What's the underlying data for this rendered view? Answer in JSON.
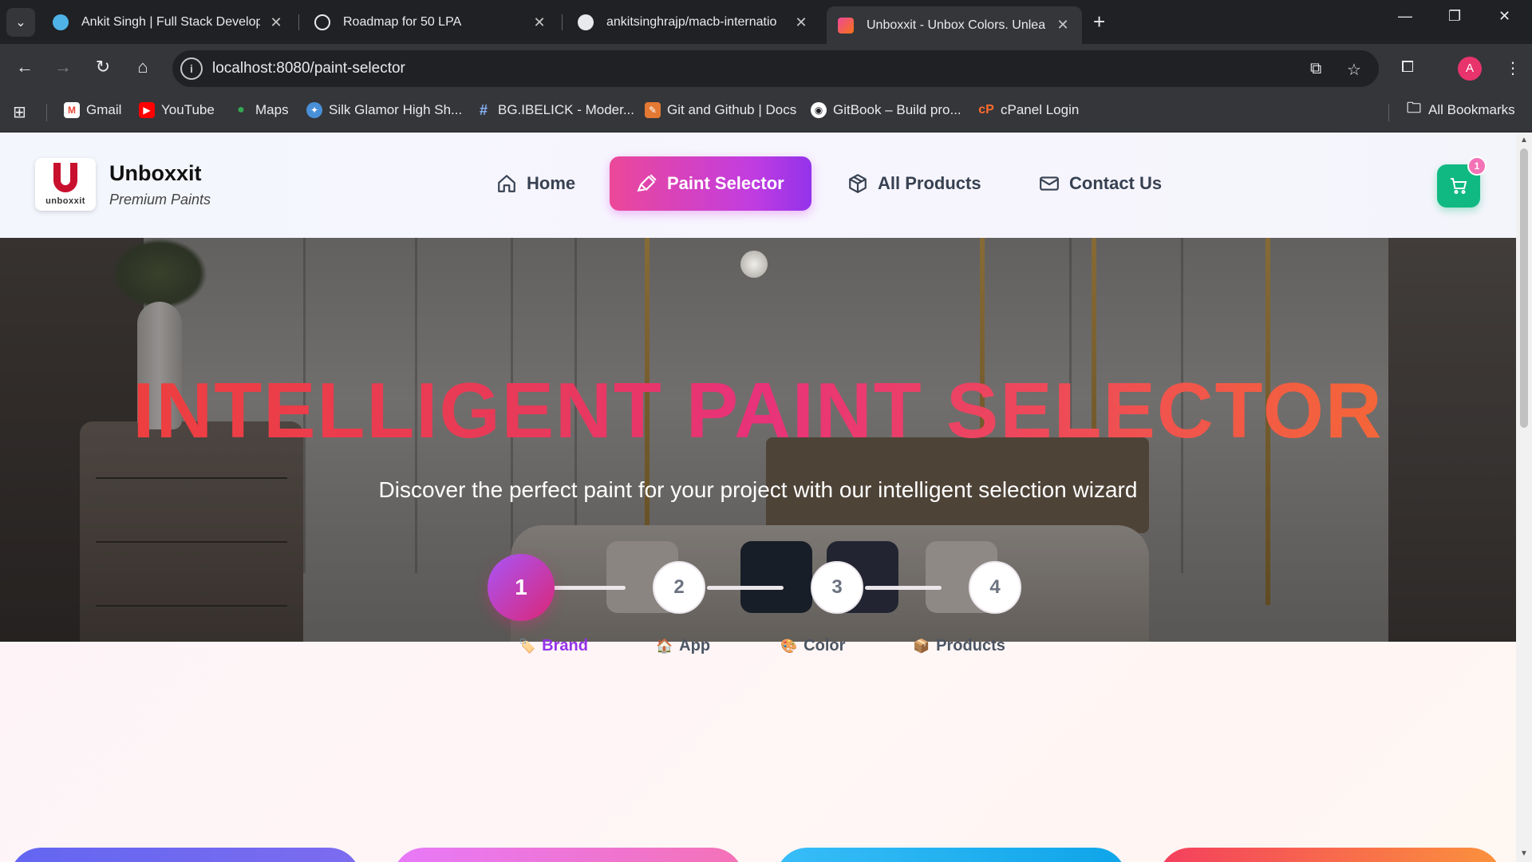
{
  "browser": {
    "tabs": [
      {
        "title": "Ankit Singh | Full Stack Develop",
        "active": false
      },
      {
        "title": "Roadmap for 50 LPA",
        "active": false
      },
      {
        "title": "ankitsinghrajp/macb-internatio",
        "active": false
      },
      {
        "title": "Unboxxit - Unbox Colors. Unlea",
        "active": true
      }
    ],
    "url": "localhost:8080/paint-selector",
    "avatar_letter": "A",
    "bookmarks": [
      "Gmail",
      "YouTube",
      "Maps",
      "Silk Glamor High Sh...",
      "BG.IBELICK - Moder...",
      "Git and Github | Docs",
      "GitBook – Build pro...",
      "cPanel Login"
    ],
    "all_bookmarks": "All Bookmarks"
  },
  "header": {
    "logo_text": "unboxxit",
    "brand": "Unboxxit",
    "tagline": "Premium Paints",
    "nav": [
      {
        "label": "Home",
        "icon": "home-icon",
        "active": false
      },
      {
        "label": "Paint Selector",
        "icon": "paint-brush-icon",
        "active": true
      },
      {
        "label": "All Products",
        "icon": "package-icon",
        "active": false
      },
      {
        "label": "Contact Us",
        "icon": "mail-icon",
        "active": false
      }
    ],
    "cart_count": "1"
  },
  "hero": {
    "title": "INTELLIGENT PAINT SELECTOR",
    "subtitle": "Discover the perfect paint for your project with our intelligent selection wizard"
  },
  "steps": [
    {
      "number": "1",
      "label": "Brand",
      "emoji": "🏷️",
      "active": true
    },
    {
      "number": "2",
      "label": "App",
      "emoji": "🏠",
      "active": false
    },
    {
      "number": "3",
      "label": "Color",
      "emoji": "🎨",
      "active": false
    },
    {
      "number": "4",
      "label": "Products",
      "emoji": "📦",
      "active": false
    }
  ],
  "colors": {
    "accent_pink": "#ec4899",
    "accent_purple": "#9333ea",
    "cart_green": "#10b981",
    "title_red": "#ef4136",
    "title_orange": "#f7712c"
  }
}
